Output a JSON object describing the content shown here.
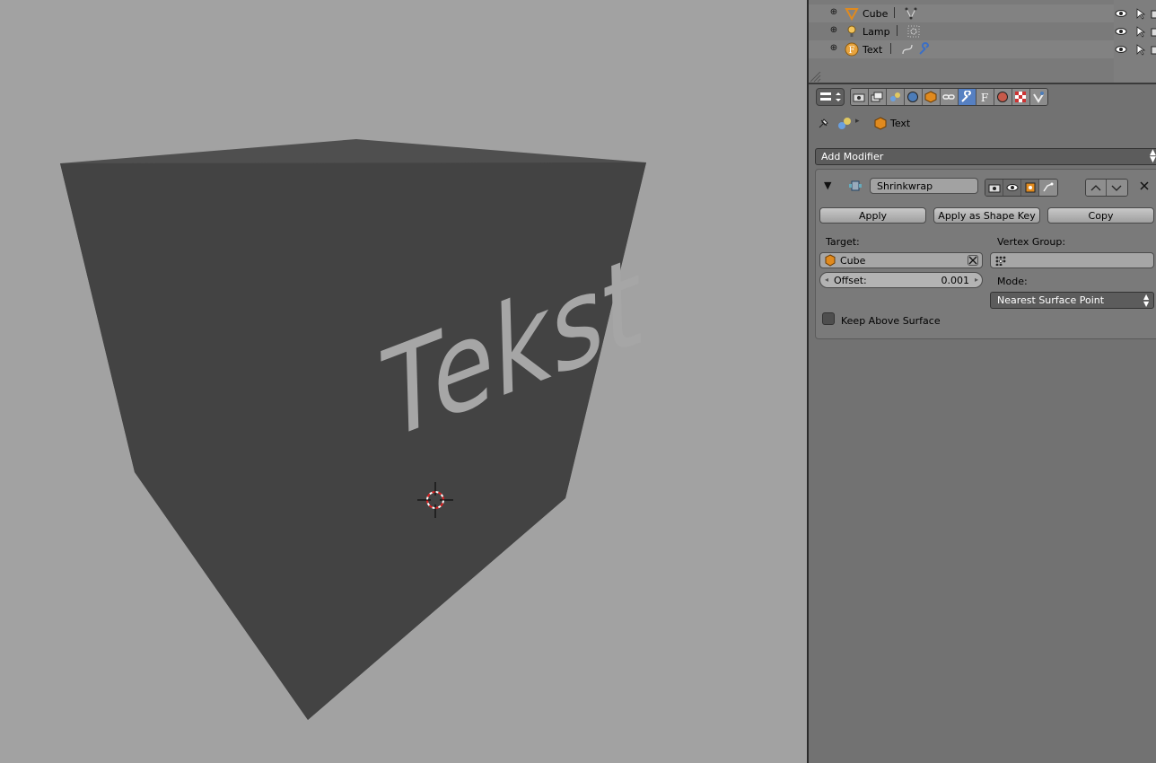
{
  "viewport": {
    "text_object_label": "Tekst"
  },
  "outliner": {
    "rows": [
      {
        "name": "Cube",
        "icon": "mesh-object-icon",
        "data_icon": "mesh-data-icon"
      },
      {
        "name": "Lamp",
        "icon": "lamp-object-icon",
        "data_icon": "lamp-data-icon"
      },
      {
        "name": "Text",
        "icon": "text-object-icon",
        "data_icon": "curve-data-icon",
        "extra_icon": "wrench-modifier-icon"
      }
    ]
  },
  "properties": {
    "active_tab": "modifiers",
    "tabs": [
      "render-icon",
      "render-layers-icon",
      "scene-icon",
      "world-icon",
      "object-icon",
      "constraints-icon",
      "modifiers-wrench-icon",
      "text-data-icon",
      "material-icon",
      "texture-icon",
      "physics-icon"
    ],
    "breadcrumb": {
      "object_name": "Text"
    },
    "add_modifier_label": "Add Modifier",
    "modifier": {
      "name": "Shrinkwrap",
      "apply_label": "Apply",
      "apply_shape_label": "Apply as Shape Key",
      "copy_label": "Copy",
      "target_label": "Target:",
      "target_value": "Cube",
      "vertex_group_label": "Vertex Group:",
      "vertex_group_value": "",
      "offset_label": "Offset:",
      "offset_value": "0.001",
      "mode_label": "Mode:",
      "mode_value": "Nearest Surface Point",
      "keep_above_label": "Keep Above Surface",
      "keep_above_checked": false
    }
  },
  "colors": {
    "viewport_bg": "#a2a2a2",
    "panel_bg": "#727272",
    "active_tab": "#5680c2"
  }
}
